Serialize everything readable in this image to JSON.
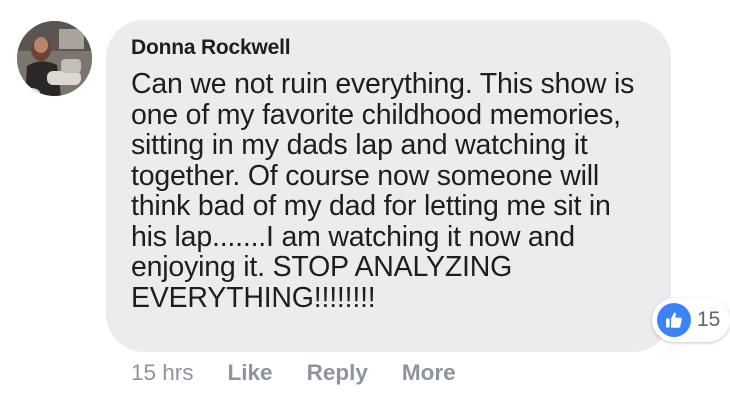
{
  "comment": {
    "author": "Donna Rockwell",
    "text": "Can we not ruin everything. This show is\none of my favorite childhood memories,\nsitting in my dads lap and watching it\ntogether. Of course now someone will\nthink bad of my dad for letting me sit in\nhis lap.......I am watching it now and\nenjoying it. STOP ANALYZING\nEVERYTHING!!!!!!!!",
    "timestamp": "15 hrs",
    "reaction_icon": "thumbs-up-icon",
    "reaction_count": "15"
  },
  "actions": {
    "like": "Like",
    "reply": "Reply",
    "more": "More"
  },
  "colors": {
    "bubble_background": "#ececee",
    "like_blue": "#3b83f6",
    "meta_text": "#8d949e"
  }
}
